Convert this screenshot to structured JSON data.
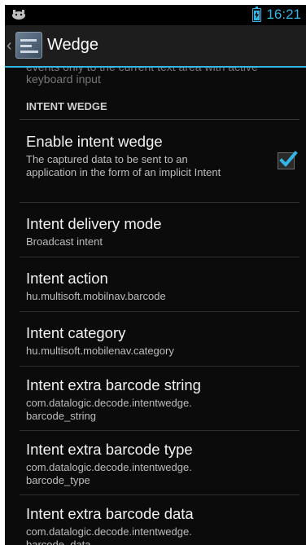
{
  "status_bar": {
    "time": "16:21"
  },
  "action_bar": {
    "title": "Wedge"
  },
  "cut_off_summary": "events only to the current text area with active keyboard input",
  "section": {
    "header": "INTENT WEDGE"
  },
  "preferences": [
    {
      "title": "Enable intent wedge",
      "summary": "The captured data to be sent to an application in the form of an implicit Intent",
      "checked": true
    },
    {
      "title": "Intent delivery mode",
      "summary": "Broadcast intent"
    },
    {
      "title": "Intent action",
      "summary": "hu.multisoft.mobilnav.barcode"
    },
    {
      "title": "Intent category",
      "summary": "hu.multisoft.mobilenav.category"
    },
    {
      "title": "Intent extra barcode string",
      "summary": "com.datalogic.decode.intentwedge.\nbarcode_string"
    },
    {
      "title": "Intent extra barcode type",
      "summary": "com.datalogic.decode.intentwedge.\nbarcode_type"
    },
    {
      "title": "Intent extra barcode data",
      "summary": "com.datalogic.decode.intentwedge.\nbarcode_data"
    }
  ]
}
